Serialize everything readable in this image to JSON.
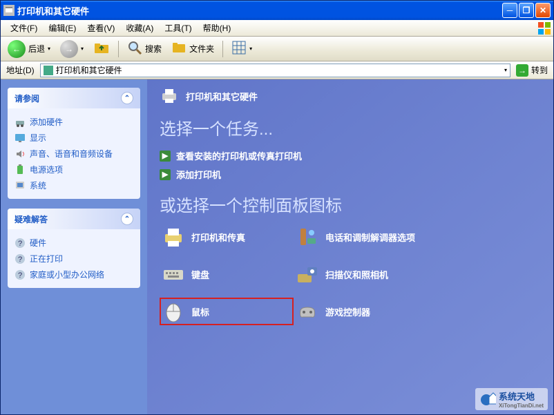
{
  "window": {
    "title": "打印机和其它硬件"
  },
  "menu": {
    "file": "文件(F)",
    "edit": "编辑(E)",
    "view": "查看(V)",
    "favorites": "收藏(A)",
    "tools": "工具(T)",
    "help": "帮助(H)"
  },
  "toolbar": {
    "back": "后退",
    "search": "搜索",
    "folders": "文件夹"
  },
  "addressbar": {
    "label": "地址(D)",
    "value": "打印机和其它硬件",
    "go": "转到"
  },
  "sidebar": {
    "see_also": {
      "title": "请参阅",
      "items": [
        {
          "icon": "hardware-icon",
          "label": "添加硬件"
        },
        {
          "icon": "display-icon",
          "label": "显示"
        },
        {
          "icon": "sound-icon",
          "label": "声音、语音和音频设备"
        },
        {
          "icon": "power-icon",
          "label": "电源选项"
        },
        {
          "icon": "system-icon",
          "label": "系统"
        }
      ]
    },
    "troubleshoot": {
      "title": "疑难解答",
      "items": [
        {
          "icon": "help-icon",
          "label": "硬件"
        },
        {
          "icon": "help-icon",
          "label": "正在打印"
        },
        {
          "icon": "help-icon",
          "label": "家庭或小型办公网络"
        }
      ]
    }
  },
  "main": {
    "header": "打印机和其它硬件",
    "pick_task": "选择一个任务...",
    "tasks": [
      "查看安装的打印机或传真打印机",
      "添加打印机"
    ],
    "pick_icon": "或选择一个控制面板图标",
    "cpls": [
      {
        "icon": "printer-icon",
        "label": "打印机和传真"
      },
      {
        "icon": "modem-icon",
        "label": "电话和调制解调器选项"
      },
      {
        "icon": "keyboard-icon",
        "label": "键盘"
      },
      {
        "icon": "scanner-icon",
        "label": "扫描仪和照相机"
      },
      {
        "icon": "mouse-icon",
        "label": "鼠标",
        "highlight": true
      },
      {
        "icon": "gamepad-icon",
        "label": "游戏控制器"
      }
    ]
  },
  "watermark": {
    "brand": "系统天地",
    "url": "XiTongTianDi.net"
  }
}
